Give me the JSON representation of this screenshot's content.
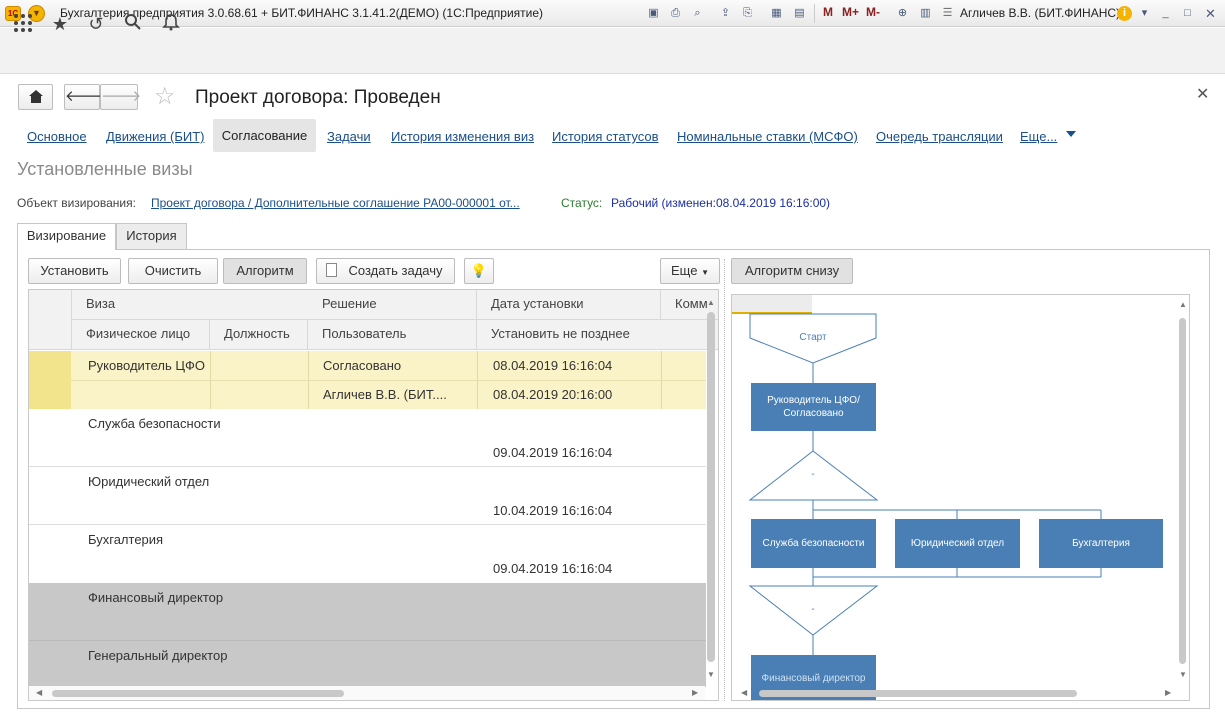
{
  "window": {
    "title": "Бухгалтерия предприятия 3.0.68.61 + БИТ.ФИНАНС 3.1.41.2(ДЕМО)  (1С:Предприятие)",
    "logo_text": "1С",
    "user": "Агличев В.В. (БИТ.ФИНАНС)",
    "m_buttons": [
      "M",
      "M+",
      "M-"
    ]
  },
  "form": {
    "title": "Проект договора: Проведен",
    "links": [
      "Основное",
      "Движения (БИТ)",
      "Согласование",
      "Задачи",
      "История изменения виз",
      "История статусов",
      "Номинальные ставки (МСФО)",
      "Очередь трансляции",
      "Еще..."
    ],
    "active_link": "Согласование",
    "section_title": "Установленные визы",
    "object_label": "Объект визирования:",
    "object_link": "Проект договора / Дополнительные соглашение РА00-000001 от...",
    "status_label": "Статус:",
    "status_value": "Рабочий (изменен:08.04.2019 16:16:00)"
  },
  "tabs": [
    "Визирование",
    "История"
  ],
  "toolbar": {
    "set": "Установить",
    "clear": "Очистить",
    "algorithm": "Алгоритм",
    "create_task": "Создать задачу",
    "more": "Еще",
    "algorithm_bottom": "Алгоритм снизу"
  },
  "grid": {
    "headers_row1": [
      "Виза",
      "Решение",
      "Дата установки",
      "Комм"
    ],
    "headers_row2": [
      "Физическое лицо",
      "Должность",
      "Пользователь",
      "Установить не позднее"
    ],
    "rows": [
      {
        "viza": "Руководитель ЦФО",
        "decision": "Согласовано",
        "date_set": "08.04.2019 16:16:04",
        "person": "",
        "position": "",
        "user": "Агличев В.В. (БИТ....",
        "deadline": "08.04.2019 20:16:00"
      },
      {
        "viza": "Служба безопасности",
        "decision": "",
        "date_set": "",
        "person": "",
        "position": "",
        "user": "",
        "deadline": "09.04.2019 16:16:04"
      },
      {
        "viza": "Юридический отдел",
        "decision": "",
        "date_set": "",
        "person": "",
        "position": "",
        "user": "",
        "deadline": "10.04.2019 16:16:04"
      },
      {
        "viza": "Бухгалтерия",
        "decision": "",
        "date_set": "",
        "person": "",
        "position": "",
        "user": "",
        "deadline": "09.04.2019 16:16:04"
      },
      {
        "viza": "Финансовый директор",
        "decision": "",
        "date_set": "",
        "person": "",
        "position": "",
        "user": "",
        "deadline": ""
      },
      {
        "viza": "Генеральный директор",
        "decision": "",
        "date_set": "",
        "person": "",
        "position": "",
        "user": "",
        "deadline": ""
      }
    ]
  },
  "flow": {
    "start": "Старт",
    "node1": "Руководитель ЦФО/Согласовано",
    "decision1": "-",
    "branch1": "Служба безопасности",
    "branch2": "Юридический отдел",
    "branch3": "Бухгалтерия",
    "decision2": "-",
    "node_last": "Финансовый директор"
  }
}
